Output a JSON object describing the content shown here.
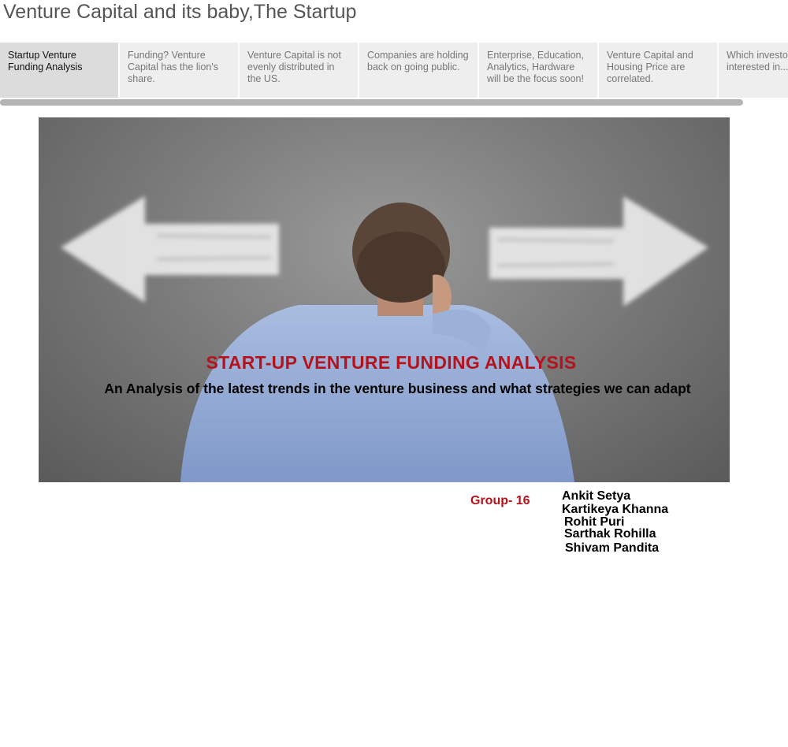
{
  "story": {
    "title": "Venture Capital and its baby,The Startup"
  },
  "tabs": [
    {
      "label": "Startup Venture Funding Analysis",
      "active": true
    },
    {
      "label": "Funding? Venture Capital has the lion's share.",
      "active": false
    },
    {
      "label": "Venture Capital is not evenly distributed in the US.",
      "active": false
    },
    {
      "label": "Companies are holding back on going public.",
      "active": false
    },
    {
      "label": "Enterprise, Education, Analytics, Hardware will be the focus soon!",
      "active": false
    },
    {
      "label": "Venture Capital and Housing Price are correlated.",
      "active": false
    },
    {
      "label": "Which investors are interested in...",
      "active": false
    }
  ],
  "hero": {
    "title": "START-UP VENTURE FUNDING ANALYSIS",
    "subtitle": "An Analysis of the latest trends in the venture business and what strategies we can adapt",
    "image_icon": "man-facing-two-arrows-image"
  },
  "group": {
    "label": "Group- 16",
    "members": [
      "Ankit Setya",
      "Kartikeya Khanna",
      "Rohit Puri",
      "Sarthak Rohilla",
      "Shivam Pandita"
    ]
  },
  "colors": {
    "accent_red": "#b5121b",
    "tab_active": "#dcdcdc",
    "tab_inactive": "#eeeeee"
  }
}
